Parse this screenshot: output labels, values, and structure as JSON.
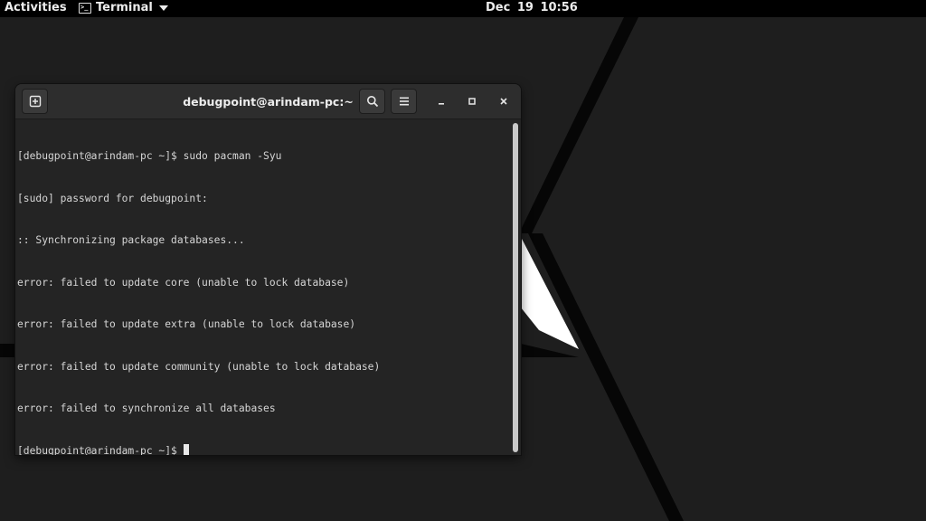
{
  "topbar": {
    "activities_label": "Activities",
    "app_name": "Terminal",
    "app_icon": "terminal-icon",
    "clock": "Dec 19  10:56"
  },
  "window": {
    "title": "debugpoint@arindam-pc:~",
    "buttons": {
      "new_tab_icon": "new-tab-icon",
      "search_icon": "search-icon",
      "menu_icon": "hamburger-menu-icon",
      "minimize_icon": "minimize-icon",
      "maximize_icon": "maximize-icon",
      "close_icon": "close-icon"
    }
  },
  "terminal": {
    "lines": [
      "[debugpoint@arindam-pc ~]$ sudo pacman -Syu",
      "[sudo] password for debugpoint:",
      ":: Synchronizing package databases...",
      "error: failed to update core (unable to lock database)",
      "error: failed to update extra (unable to lock database)",
      "error: failed to update community (unable to lock database)",
      "error: failed to synchronize all databases"
    ],
    "prompt": "[debugpoint@arindam-pc ~]$ "
  },
  "colors": {
    "desktop": "#1e1e1e",
    "topbar": "#000000",
    "terminal_bg": "#242424",
    "terminal_fg": "#d6d6d6",
    "headerbar": "#2d2d2d"
  }
}
